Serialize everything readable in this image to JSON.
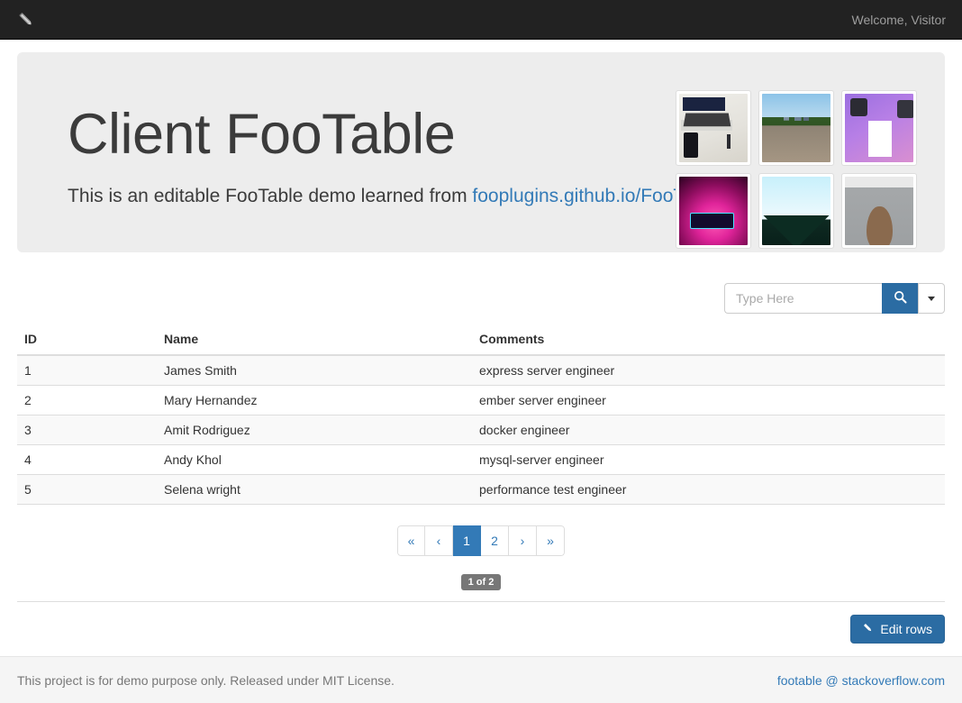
{
  "navbar": {
    "brand_icon": "pencil-icon",
    "welcome": "Welcome, Visitor"
  },
  "jumbotron": {
    "title": "Client FooTable",
    "lead_prefix": "This is an editable FooTable demo learned from ",
    "lead_link": "fooplugins.github.io/FooTable",
    "thumbnails": [
      {
        "name": "laptop-electronics-photo",
        "art": "art-laptop"
      },
      {
        "name": "city-skyline-photo",
        "art": "art-city"
      },
      {
        "name": "tshirt-merch-graphic",
        "art": "art-shirt"
      },
      {
        "name": "neon-gaming-room-photo",
        "art": "art-neon"
      },
      {
        "name": "sky-landscape-photo",
        "art": "art-sky"
      },
      {
        "name": "webcam-portrait-photo",
        "art": "art-webcam"
      }
    ]
  },
  "search": {
    "placeholder": "Type Here",
    "value": "",
    "search_icon": "magnifier-icon",
    "dropdown_icon": "caret-down-icon"
  },
  "table": {
    "columns": [
      "ID",
      "Name",
      "Comments"
    ],
    "rows": [
      {
        "id": "1",
        "name": "James Smith",
        "comments": "express server engineer"
      },
      {
        "id": "2",
        "name": "Mary Hernandez",
        "comments": "ember server engineer"
      },
      {
        "id": "3",
        "name": "Amit Rodriguez",
        "comments": "docker engineer"
      },
      {
        "id": "4",
        "name": "Andy Khol",
        "comments": "mysql-server engineer"
      },
      {
        "id": "5",
        "name": "Selena wright",
        "comments": "performance test engineer"
      }
    ]
  },
  "pagination": {
    "items": [
      {
        "label": "«",
        "name": "page-first",
        "active": false
      },
      {
        "label": "‹",
        "name": "page-prev",
        "active": false
      },
      {
        "label": "1",
        "name": "page-1",
        "active": true
      },
      {
        "label": "2",
        "name": "page-2",
        "active": false
      },
      {
        "label": "›",
        "name": "page-next",
        "active": false
      },
      {
        "label": "»",
        "name": "page-last",
        "active": false
      }
    ],
    "counter": "1 of 2"
  },
  "actions": {
    "edit_rows_label": "Edit rows",
    "edit_rows_icon": "pencil-icon"
  },
  "footer": {
    "text": "This project is for demo purpose only. Released under MIT License.",
    "link": "footable @ stackoverflow.com"
  },
  "colors": {
    "navbar_bg": "#222222",
    "accent": "#337ab7",
    "button_blue": "#2b6ca3",
    "jumbotron_bg": "#ededed",
    "footer_bg": "#f5f5f5",
    "badge_grey": "#777777",
    "row_stripe": "#f9f9f9"
  }
}
